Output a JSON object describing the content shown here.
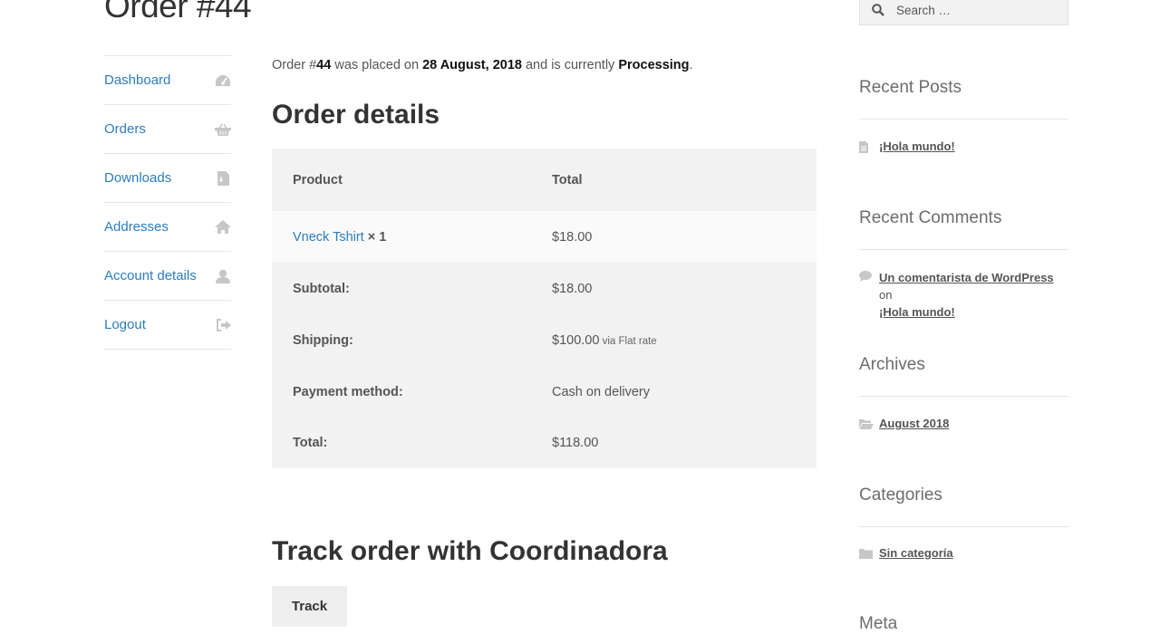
{
  "page": {
    "title": "Order #44"
  },
  "account_nav": {
    "items": [
      {
        "label": "Dashboard",
        "icon": "dashboard-icon"
      },
      {
        "label": "Orders",
        "icon": "basket-icon"
      },
      {
        "label": "Downloads",
        "icon": "file-download-icon"
      },
      {
        "label": "Addresses",
        "icon": "home-icon"
      },
      {
        "label": "Account details",
        "icon": "user-icon"
      },
      {
        "label": "Logout",
        "icon": "sign-out-icon"
      }
    ]
  },
  "order": {
    "intro_prefix": "Order #",
    "number": "44",
    "intro_placed": " was placed on ",
    "date": "28 August, 2018",
    "intro_status": " and is currently ",
    "status": "Processing",
    "intro_end": ".",
    "details_heading": "Order details",
    "table": {
      "headers": {
        "product": "Product",
        "total": "Total"
      },
      "item": {
        "name": "Vneck Tshirt",
        "qty": " × 1",
        "total": "$18.00"
      },
      "footer": [
        {
          "label": "Subtotal:",
          "value": "$18.00",
          "note": ""
        },
        {
          "label": "Shipping:",
          "value": "$100.00",
          "note": " via Flat rate"
        },
        {
          "label": "Payment method:",
          "value": "Cash on delivery",
          "note": ""
        },
        {
          "label": "Total:",
          "value": "$118.00",
          "note": ""
        }
      ]
    },
    "track_heading": "Track order with Coordinadora",
    "track_button": "Track"
  },
  "sidebar": {
    "search_placeholder": "Search …",
    "recent_posts": {
      "title": "Recent Posts",
      "items": [
        "¡Hola mundo!"
      ]
    },
    "recent_comments": {
      "title": "Recent Comments",
      "author": "Un comentarista de WordPress",
      "on": " on",
      "post": "¡Hola mundo!"
    },
    "archives": {
      "title": "Archives",
      "items": [
        "August 2018"
      ]
    },
    "categories": {
      "title": "Categories",
      "items": [
        "Sin categoría"
      ]
    },
    "meta": {
      "title": "Meta"
    }
  },
  "colors": {
    "link": "#2c7dbf",
    "icon": "#c7c7c7",
    "table_bg": "#f2f2f2"
  }
}
